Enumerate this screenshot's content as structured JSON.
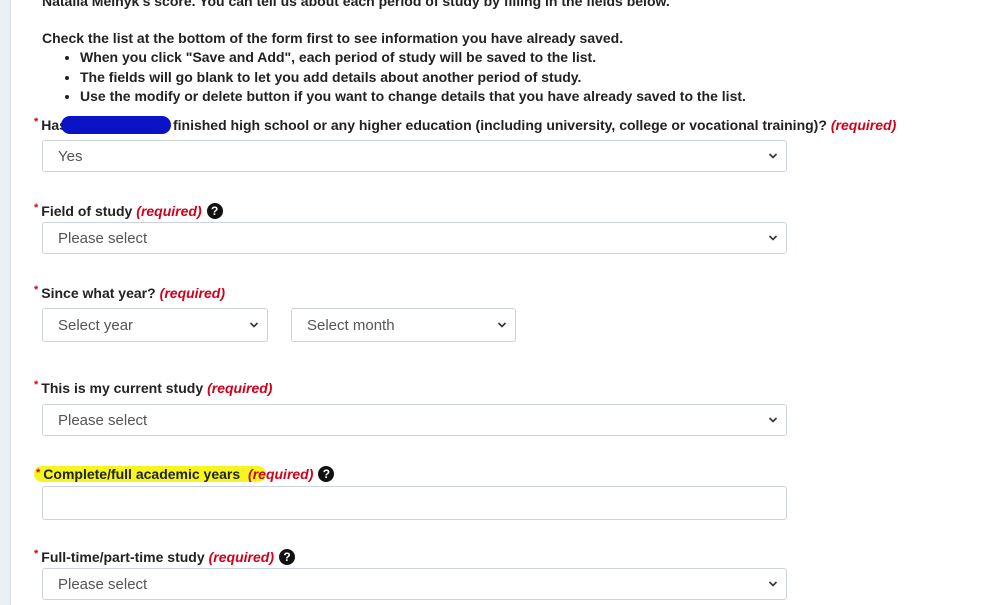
{
  "intro": {
    "top_line": "Natalia Melnyk's score. You can tell us about each period of study by filling in the fields below.",
    "check_line": "Check the list at the bottom of the form first to see information you have already saved.",
    "bullets": [
      "When you click \"Save and Add\", each period of study will be saved to the list.",
      "The fields will go blank to let you add details about another period of study.",
      "Use the modify or delete button if you want to change details that you have already saved to the list."
    ]
  },
  "form": {
    "asterisk": "*",
    "required_text": "(required)",
    "help_glyph": "?",
    "higher_education": {
      "label_start": "Has",
      "label_end": "finished high school or any higher education (including university, college or vocational training)?",
      "value": "Yes"
    },
    "field_of_study": {
      "label": "Field of study",
      "value": "Please select"
    },
    "since_year": {
      "label": "Since what year?",
      "year_value": "Select year",
      "month_value": "Select month"
    },
    "current_study": {
      "label": "This is my current study",
      "value": "Please select"
    },
    "academic_years": {
      "label": "Complete/full academic years",
      "required_highlight_part": "(re",
      "required_rest": "quired)",
      "value": ""
    },
    "study_mode": {
      "label": "Full-time/part-time study",
      "value": "Please select"
    }
  },
  "colors": {
    "required_red": "#d0021b",
    "redaction_blue": "#0b13c6",
    "highlight_yellow": "#f5f522"
  }
}
